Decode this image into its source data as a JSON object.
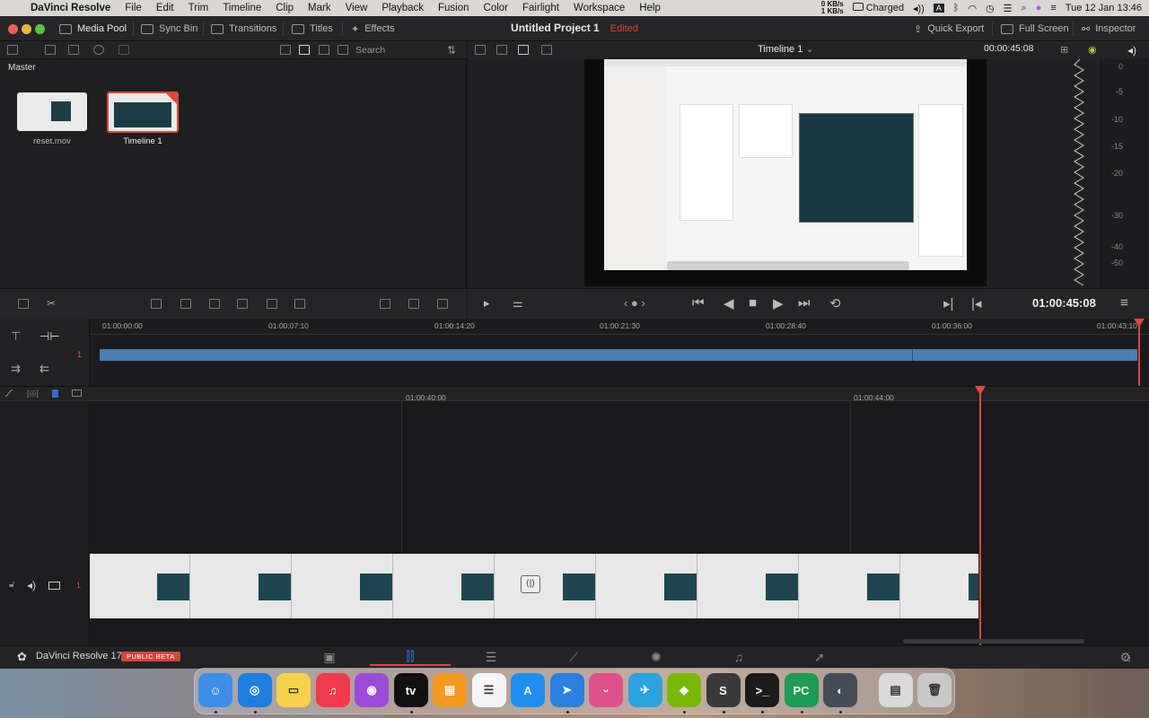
{
  "menubar": {
    "app_name": "DaVinci Resolve",
    "items": [
      "File",
      "Edit",
      "Trim",
      "Timeline",
      "Clip",
      "Mark",
      "View",
      "Playback",
      "Fusion",
      "Color",
      "Fairlight",
      "Workspace",
      "Help"
    ],
    "net_up": "0 KB/s",
    "net_down": "1 KB/s",
    "battery": "Charged",
    "clock": "Tue 12 Jan  13:46"
  },
  "titlebar": {
    "media_pool": "Media Pool",
    "sync_bin": "Sync Bin",
    "transitions": "Transitions",
    "titles": "Titles",
    "effects": "Effects",
    "project_title": "Untitled Project 1",
    "edited": "Edited",
    "quick_export": "Quick Export",
    "full_screen": "Full Screen",
    "inspector": "Inspector"
  },
  "mediapool": {
    "search_placeholder": "Search",
    "bin_title": "Master",
    "clips": [
      {
        "name": "reset.mov"
      },
      {
        "name": "Timeline 1"
      }
    ]
  },
  "viewer": {
    "timeline_name": "Timeline 1",
    "timecode_top": "00:00:45:08",
    "timecode_main": "01:00:45:08",
    "meter_labels": [
      "0",
      "-5",
      "-10",
      "-15",
      "-20",
      "-30",
      "-40",
      "-50"
    ]
  },
  "ruler_top": [
    "01:00:00:00",
    "01:00:07:10",
    "01:00:14:20",
    "01:00:21:30",
    "01:00:28:40",
    "01:00:36:00",
    "01:00:43:10"
  ],
  "ruler_bottom": [
    "01:00:40:00",
    "01:00:44:00"
  ],
  "tracks": {
    "video_track_number": "1",
    "lower_track_number": "1"
  },
  "bottombar": {
    "app_label": "DaVinci Resolve 17",
    "beta_label": "PUBLIC BETA"
  },
  "dock_apps": [
    {
      "name": "Finder",
      "color": "#3d8ee8"
    },
    {
      "name": "Safari",
      "color": "#1f7de0"
    },
    {
      "name": "Notes",
      "color": "#f6d24a"
    },
    {
      "name": "Music",
      "color": "#f2394e"
    },
    {
      "name": "Podcasts",
      "color": "#9b4bd8"
    },
    {
      "name": "TV",
      "color": "#111111"
    },
    {
      "name": "Books",
      "color": "#f39a1f"
    },
    {
      "name": "Reminders",
      "color": "#f5f5f5"
    },
    {
      "name": "App Store",
      "color": "#1e8ef0"
    },
    {
      "name": "Navigator",
      "color": "#2a7fe0"
    },
    {
      "name": "Kawaii",
      "color": "#e0508a"
    },
    {
      "name": "Telegram",
      "color": "#2aa3e0"
    },
    {
      "name": "Nvidia",
      "color": "#76b900"
    },
    {
      "name": "Sublime",
      "color": "#3a3a3a"
    },
    {
      "name": "Terminal",
      "color": "#1a1a1a"
    },
    {
      "name": "PyCharm",
      "color": "#1d9a53"
    },
    {
      "name": "DaVinci",
      "color": "#444c58"
    },
    {
      "name": "Preview",
      "color": "#d9d9d9"
    },
    {
      "name": "Trash",
      "color": "#c8c8c8"
    }
  ]
}
